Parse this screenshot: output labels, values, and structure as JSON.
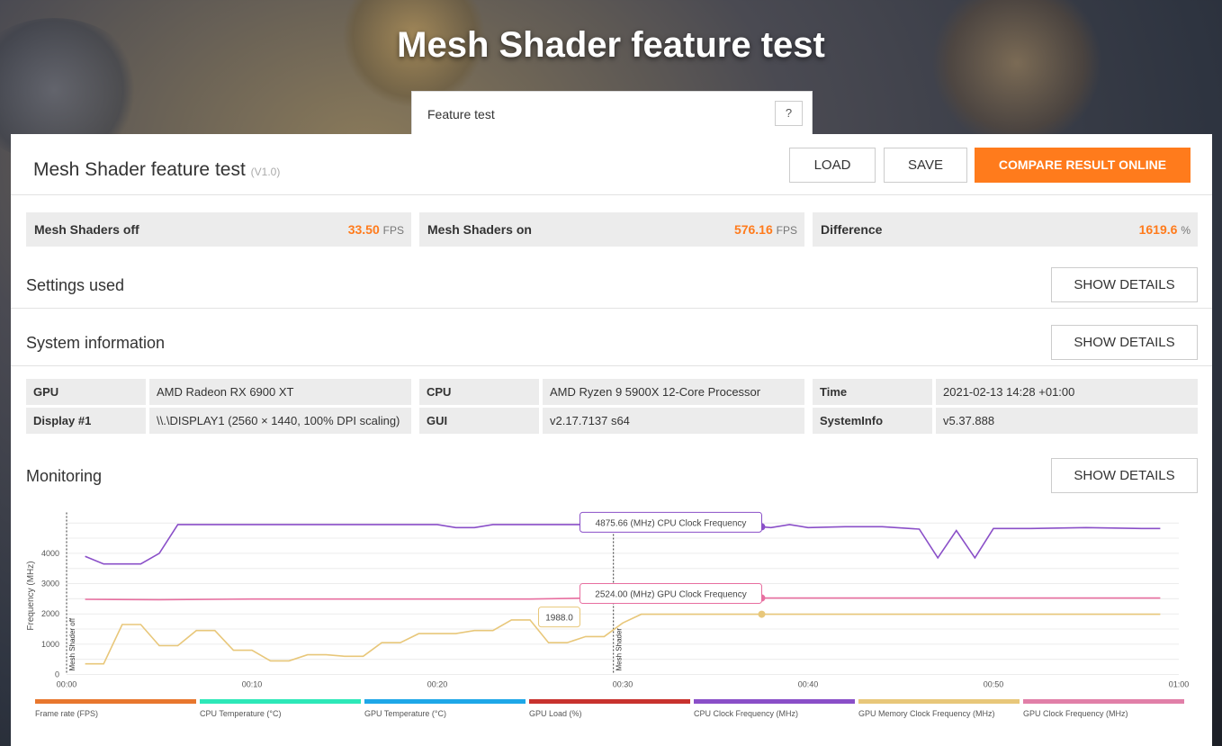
{
  "hero": {
    "title": "Mesh Shader feature test"
  },
  "test_select": {
    "label": "Feature test",
    "help": "?"
  },
  "result": {
    "title": "Mesh Shader feature test",
    "version": "(V1.0)",
    "buttons": {
      "load": "LOAD",
      "save": "SAVE",
      "compare": "COMPARE RESULT ONLINE"
    }
  },
  "scores": [
    {
      "name": "Mesh Shaders off",
      "value": "33.50",
      "unit": "FPS"
    },
    {
      "name": "Mesh Shaders on",
      "value": "576.16",
      "unit": "FPS"
    },
    {
      "name": "Difference",
      "value": "1619.6",
      "unit": "%"
    }
  ],
  "sections": {
    "settings": {
      "title": "Settings used",
      "button": "SHOW DETAILS"
    },
    "system": {
      "title": "System information",
      "button": "SHOW DETAILS"
    },
    "monitoring": {
      "title": "Monitoring",
      "button": "SHOW DETAILS"
    }
  },
  "system_info": [
    {
      "key": "GPU",
      "value": "AMD Radeon RX 6900 XT"
    },
    {
      "key": "CPU",
      "value": "AMD Ryzen 9 5900X 12-Core Processor"
    },
    {
      "key": "Time",
      "value": "2021-02-13 14:28 +01:00"
    },
    {
      "key": "Display #1",
      "value": "\\\\.\\DISPLAY1 (2560 × 1440, 100% DPI scaling)"
    },
    {
      "key": "GUI",
      "value": "v2.17.7137 s64"
    },
    {
      "key": "SystemInfo",
      "value": "v5.37.888"
    }
  ],
  "chart_data": {
    "type": "line",
    "ylabel": "Frequency (MHz)",
    "xlabel": "",
    "y_ticks": [
      "0",
      "1000",
      "2000",
      "3000",
      "4000"
    ],
    "x_ticks": [
      "00:00",
      "00:10",
      "00:20",
      "00:30",
      "00:40",
      "00:50",
      "01:00"
    ],
    "xlim": [
      0,
      60
    ],
    "ylim": [
      0,
      5200
    ],
    "markers": [
      {
        "x": 0,
        "label": "Mesh Shader off"
      },
      {
        "x": 29.5,
        "label": "Mesh Shader"
      }
    ],
    "series": [
      {
        "name": "CPU Clock Frequency (MHz)",
        "color": "#8a4fc8",
        "x": [
          1,
          2,
          3,
          4,
          5,
          6,
          7,
          10,
          15,
          20,
          21,
          22,
          23,
          25,
          28,
          30,
          32,
          35,
          37.5,
          38,
          39,
          40,
          42,
          44,
          46,
          47,
          48,
          49,
          50,
          52,
          55,
          58,
          59
        ],
        "values": [
          3900,
          3650,
          3650,
          3650,
          4000,
          4950,
          4950,
          4950,
          4950,
          4950,
          4850,
          4850,
          4950,
          4950,
          4950,
          4850,
          4850,
          4900,
          4875.66,
          4850,
          4950,
          4850,
          4880,
          4880,
          4800,
          3850,
          4750,
          3850,
          4820,
          4820,
          4850,
          4820,
          4820
        ]
      },
      {
        "name": "GPU Clock Frequency (MHz)",
        "color": "#e86fa0",
        "x": [
          1,
          5,
          10,
          15,
          20,
          25,
          28,
          30,
          35,
          37.5,
          40,
          45,
          50,
          55,
          59
        ],
        "values": [
          2480,
          2470,
          2490,
          2490,
          2490,
          2490,
          2520,
          2524,
          2524,
          2524,
          2524,
          2524,
          2524,
          2524,
          2524
        ]
      },
      {
        "name": "GPU Memory Clock Frequency (MHz)",
        "color": "#e8c77a",
        "x": [
          1,
          2,
          3,
          4,
          5,
          6,
          7,
          8,
          9,
          10,
          11,
          12,
          13,
          14,
          15,
          16,
          17,
          18,
          19,
          20,
          21,
          22,
          23,
          24,
          25,
          26,
          27,
          28,
          29,
          30,
          31,
          35,
          37.5,
          40,
          45,
          50,
          55,
          59
        ],
        "values": [
          350,
          350,
          1650,
          1650,
          950,
          950,
          1450,
          1450,
          800,
          800,
          450,
          450,
          650,
          650,
          600,
          600,
          1050,
          1050,
          1350,
          1350,
          1350,
          1450,
          1450,
          1800,
          1800,
          1050,
          1050,
          1250,
          1250,
          1700,
          1988,
          1988,
          1988,
          1988,
          1988,
          1988,
          1988,
          1988
        ]
      }
    ],
    "tooltips": [
      {
        "text": "4875.66 (MHz) CPU Clock Frequency",
        "series": "CPU Clock Frequency (MHz)",
        "x": 37.5,
        "y": 4875.66
      },
      {
        "text": "2524.00 (MHz) GPU Clock Frequency",
        "series": "GPU Clock Frequency (MHz)",
        "x": 37.5,
        "y": 2524
      },
      {
        "text": "1988.0",
        "series": "GPU Memory Clock Frequency (MHz)",
        "x": 37.5,
        "y": 1988
      }
    ]
  },
  "legend": [
    {
      "label": "Frame rate (FPS)",
      "color": "#e8772e"
    },
    {
      "label": "CPU Temperature (°C)",
      "color": "#2de8b8"
    },
    {
      "label": "GPU Temperature (°C)",
      "color": "#1ea7e8"
    },
    {
      "label": "GPU Load (%)",
      "color": "#c8322e"
    },
    {
      "label": "CPU Clock Frequency (MHz)",
      "color": "#8a4fc8"
    },
    {
      "label": "GPU Memory Clock Frequency (MHz)",
      "color": "#e8c77a"
    },
    {
      "label": "GPU Clock Frequency (MHz)",
      "color": "#e17fa8"
    }
  ]
}
